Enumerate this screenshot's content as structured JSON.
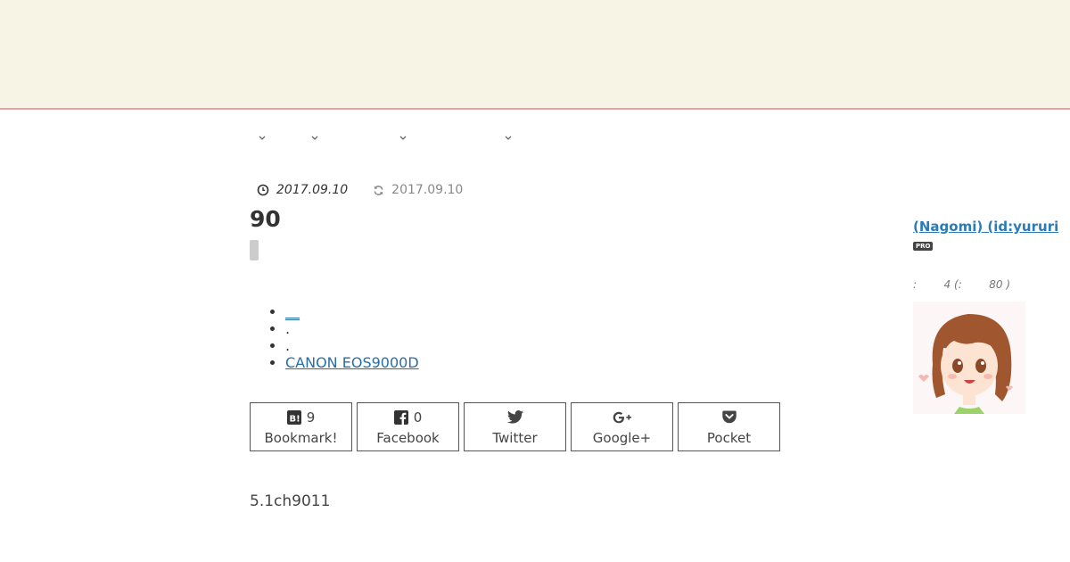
{
  "nav": {
    "items": [
      {
        "label": "",
        "icon": "chevron-down-icon"
      },
      {
        "label": "",
        "icon": "chevron-down-icon"
      },
      {
        "label": "",
        "icon": "chevron-down-icon"
      },
      {
        "label": "",
        "icon": "chevron-down-icon"
      }
    ]
  },
  "article": {
    "published_date": "2017.09.10",
    "updated_date": "2017.09.10",
    "title": "90",
    "toc": [
      "__",
      ".",
      ".",
      "CANON EOS9000D"
    ],
    "body_text": "5.1ch9011"
  },
  "share": {
    "hatena": {
      "label": "Bookmark!",
      "count": "9",
      "icon": "hatena-bookmark-icon"
    },
    "facebook": {
      "label": "Facebook",
      "count": "0",
      "icon": "facebook-icon"
    },
    "twitter": {
      "label": "Twitter",
      "icon": "twitter-icon"
    },
    "google": {
      "label": "Google+",
      "icon": "google-plus-icon"
    },
    "pocket": {
      "label": "Pocket",
      "icon": "pocket-icon"
    }
  },
  "sidebar": {
    "author_link": " (Nagomi)  (id:yururi",
    "badge": "PRO",
    "stats": ":        4 (:        80 )"
  },
  "colors": {
    "header_bg": "#f7f3e5",
    "header_border": "#e4a4a4",
    "link": "#2a6ea6"
  }
}
